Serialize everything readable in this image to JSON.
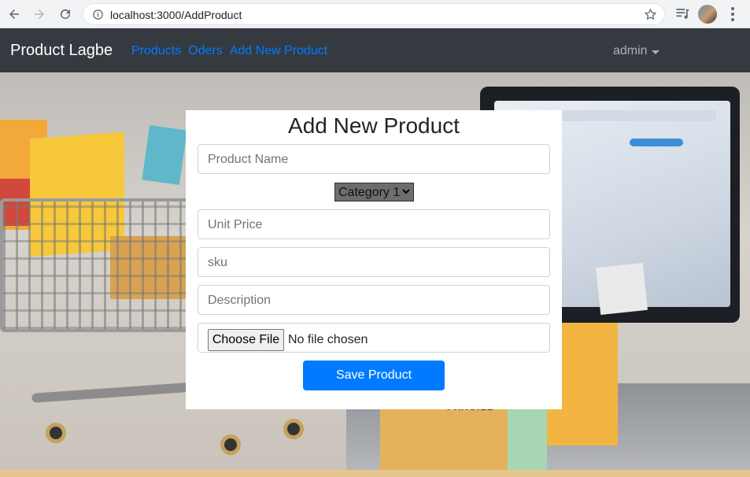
{
  "browser": {
    "url": "localhost:3000/AddProduct",
    "icons": [
      "back-arrow-icon",
      "forward-arrow-icon",
      "reload-icon",
      "info-icon",
      "star-icon",
      "playlist-icon",
      "profile-avatar",
      "more-menu-icon"
    ]
  },
  "navbar": {
    "brand": "Product Lagbe",
    "links": [
      "Products",
      "Oders",
      "Add New Product"
    ],
    "user": "admin",
    "link_color": "#007bff",
    "background": "#343a40"
  },
  "hero": {
    "label_text": "FRAGILE"
  },
  "form": {
    "title": "Add New Product",
    "product_name_placeholder": "Product Name",
    "category_selected": "Category 1",
    "unit_price_placeholder": "Unit Price",
    "sku_placeholder": "sku",
    "description_placeholder": "Description",
    "file_button_label": "Choose File",
    "file_status": "No file chosen",
    "save_label": "Save Product",
    "save_color": "#007bff"
  }
}
